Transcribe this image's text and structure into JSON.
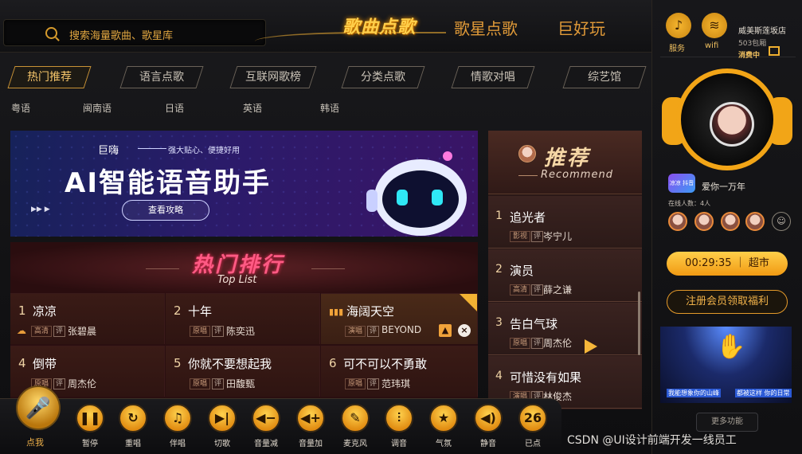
{
  "search": {
    "placeholder": "搜索海量歌曲、歌星库"
  },
  "nav": {
    "logo": "歌曲点歌",
    "tabs": [
      "歌星点歌",
      "巨好玩"
    ]
  },
  "categories": [
    "热门推荐",
    "语言点歌",
    "互联网歌榜",
    "分类点歌",
    "情歌对唱",
    "综艺馆"
  ],
  "languages": [
    "粤语",
    "闽南语",
    "日语",
    "英语",
    "韩语"
  ],
  "banner": {
    "brand": "巨嗨",
    "slogan": "强大贴心、便捷好用",
    "headline": "AI智能语音助手",
    "play": "▶▶   ▶",
    "button": "查看攻略"
  },
  "toplist": {
    "title": "热门排行",
    "subtitle": "Top List",
    "songs": [
      {
        "num": "1",
        "title": "凉凉",
        "badge": "高清",
        "ping": "评",
        "singer": "张碧晨"
      },
      {
        "num": "2",
        "title": "十年",
        "badge": "原唱",
        "ping": "评",
        "singer": "陈奕迅"
      },
      {
        "num": "",
        "title": "海阔天空",
        "badge": "演唱",
        "ping": "评",
        "singer": "BEYOND"
      },
      {
        "num": "4",
        "title": "倒带",
        "badge": "原唱",
        "ping": "评",
        "singer": "周杰伦"
      },
      {
        "num": "5",
        "title": "你就不要想起我",
        "badge": "原唱",
        "ping": "评",
        "singer": "田馥甄"
      },
      {
        "num": "6",
        "title": "可不可以不勇敢",
        "badge": "原唱",
        "ping": "评",
        "singer": "范玮琪"
      }
    ]
  },
  "recommend": {
    "title": "推荐",
    "subtitle": "Recommend",
    "songs": [
      {
        "num": "1",
        "title": "追光者",
        "badge": "影视",
        "ping": "评",
        "singer": "岑宁儿"
      },
      {
        "num": "2",
        "title": "演员",
        "badge": "高清",
        "ping": "评",
        "singer": "薛之谦"
      },
      {
        "num": "3",
        "title": "告白气球",
        "badge": "原唱",
        "ping": "评",
        "singer": "周杰伦"
      },
      {
        "num": "4",
        "title": "可惜没有如果",
        "badge": "演唱",
        "ping": "评",
        "singer": "林俊杰"
      }
    ]
  },
  "sidebar": {
    "service": "服务",
    "wifi": "wifi",
    "shop": "威美斯莲坂店",
    "room": "503包厢",
    "status": "消费中",
    "now_playing": "爱你一万年",
    "song_icon": "凉凉 抖音",
    "online": "在线人数：4人",
    "timer": "00:29:35 ｜ 超市",
    "member": "注册会员领取福利",
    "ad_cap1": "我能想象你的山峰",
    "ad_cap2": "都被这样 你的日常",
    "more": "更多功能"
  },
  "controls": {
    "main": "点我",
    "items": [
      "暂停",
      "重唱",
      "伴唱",
      "切歌",
      "音量减",
      "音量加",
      "麦克风",
      "调音",
      "气氛",
      "静音",
      "已点"
    ],
    "ordered_count": "26"
  },
  "watermark": "CSDN @UI设计前端开发一线员工"
}
